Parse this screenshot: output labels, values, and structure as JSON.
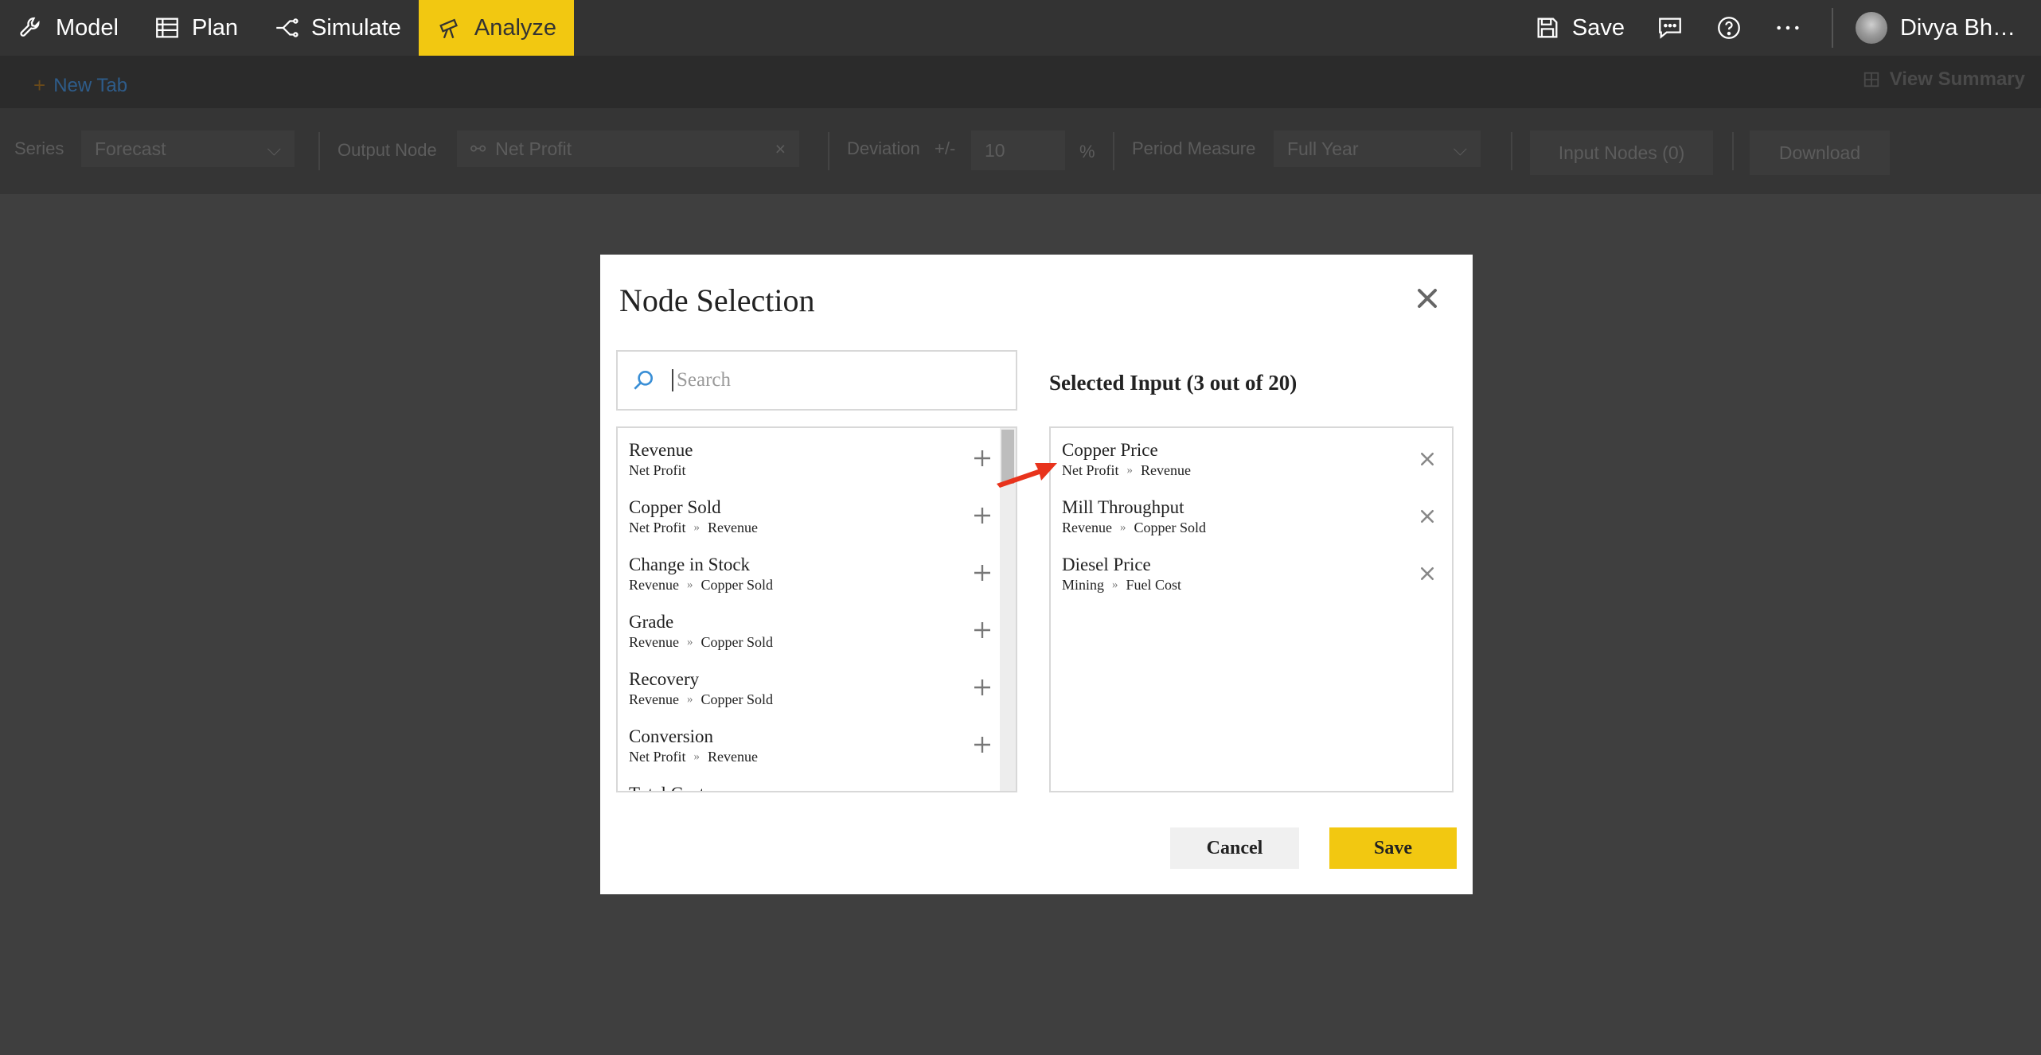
{
  "nav": {
    "items": [
      {
        "label": "Model",
        "icon": "wrench-icon"
      },
      {
        "label": "Plan",
        "icon": "table-icon"
      },
      {
        "label": "Simulate",
        "icon": "branch-icon"
      },
      {
        "label": "Analyze",
        "icon": "telescope-icon",
        "active": true
      }
    ],
    "save_label": "Save",
    "user_name": "Divya Bh…"
  },
  "tabbar": {
    "new_tab_label": "New Tab",
    "view_summary_label": "View Summary"
  },
  "toolbar": {
    "series_label": "Series",
    "series_value": "Forecast",
    "output_node_label": "Output Node",
    "output_node_value": "Net Profit",
    "deviation_label": "Deviation",
    "deviation_sign": "+/-",
    "deviation_value": "10",
    "deviation_unit": "%",
    "period_label": "Period Measure",
    "period_value": "Full Year",
    "input_nodes_label": "Input Nodes (0)",
    "download_label": "Download"
  },
  "modal": {
    "title": "Node Selection",
    "search_placeholder": "Search",
    "selected_title": "Selected Input (3 out of 20)",
    "available": [
      {
        "name": "Revenue",
        "path": [
          "Net Profit"
        ]
      },
      {
        "name": "Copper Sold",
        "path": [
          "Net Profit",
          "Revenue"
        ]
      },
      {
        "name": "Change in Stock",
        "path": [
          "Revenue",
          "Copper Sold"
        ]
      },
      {
        "name": "Grade",
        "path": [
          "Revenue",
          "Copper Sold"
        ]
      },
      {
        "name": "Recovery",
        "path": [
          "Revenue",
          "Copper Sold"
        ]
      },
      {
        "name": "Conversion",
        "path": [
          "Net Profit",
          "Revenue"
        ]
      },
      {
        "name": "Total Cost",
        "path": []
      }
    ],
    "selected": [
      {
        "name": "Copper Price",
        "path": [
          "Net Profit",
          "Revenue"
        ]
      },
      {
        "name": "Mill Throughput",
        "path": [
          "Revenue",
          "Copper Sold"
        ]
      },
      {
        "name": "Diesel Price",
        "path": [
          "Mining",
          "Fuel Cost"
        ]
      }
    ],
    "cancel_label": "Cancel",
    "save_label": "Save"
  },
  "colors": {
    "accent": "#f2c811",
    "nav_bg": "#333333",
    "backdrop": "#3f3f3f",
    "annotation_arrow": "#e8331c"
  }
}
